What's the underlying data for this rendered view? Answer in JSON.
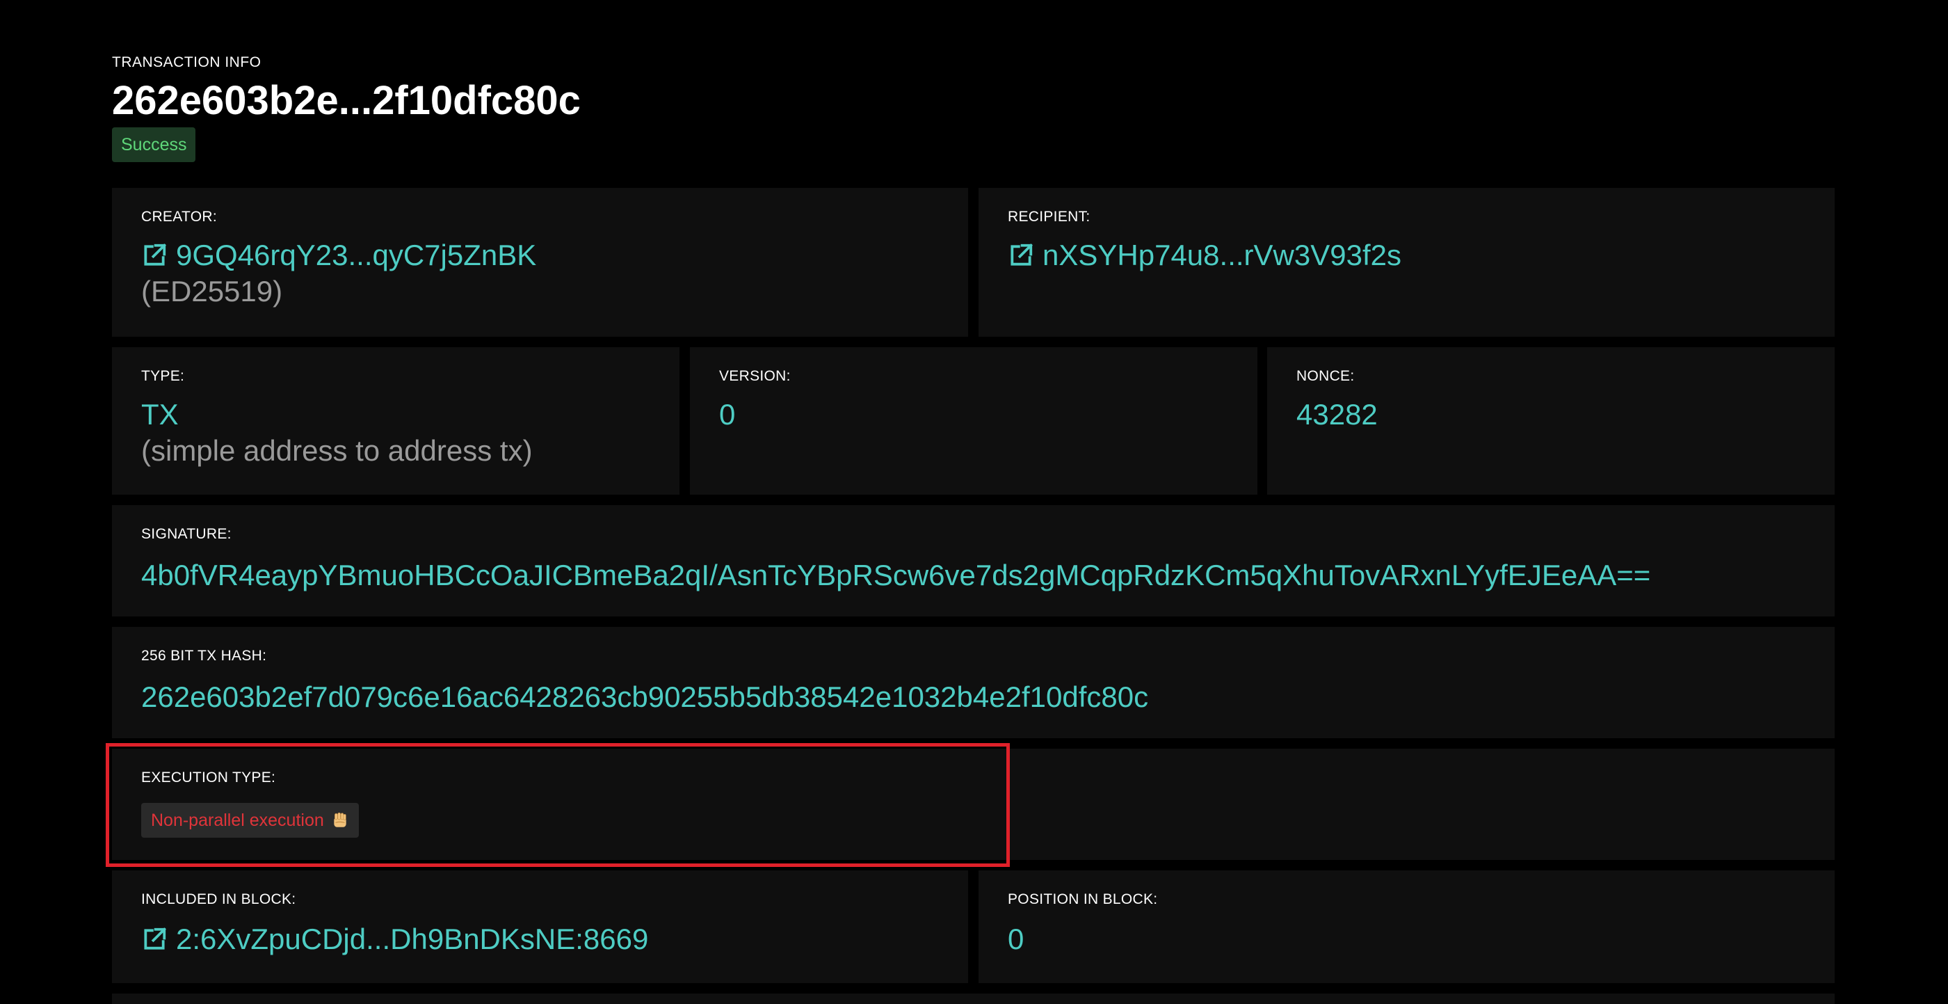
{
  "header": {
    "eyebrow": "TRANSACTION INFO",
    "title": "262e603b2e...2f10dfc80c",
    "status": "Success"
  },
  "creator": {
    "label": "CREATOR:",
    "value": "9GQ46rqY23...qyC7j5ZnBK",
    "sub": "(ED25519)",
    "icon": "external-link-icon"
  },
  "recipient": {
    "label": "RECIPIENT:",
    "value": "nXSYHp74u8...rVw3V93f2s",
    "icon": "external-link-icon"
  },
  "type": {
    "label": "TYPE:",
    "value": "TX",
    "sub": "(simple address to address tx)"
  },
  "version": {
    "label": "VERSION:",
    "value": "0"
  },
  "nonce": {
    "label": "NONCE:",
    "value": "43282"
  },
  "signature": {
    "label": "SIGNATURE:",
    "value": "4b0fVR4eaypYBmuoHBCcOaJICBmeBa2qI/AsnTcYBpRScw6ve7ds2gMCqpRdzKCm5qXhuTovARxnLYyfEJEeAA=="
  },
  "tx_hash": {
    "label": "256 BIT TX HASH:",
    "value": "262e603b2ef7d079c6e16ac6428263cb90255b5db38542e1032b4e2f10dfc80c"
  },
  "execution": {
    "label": "EXECUTION TYPE:",
    "value": "Non-parallel execution",
    "icon": "raised-fist-emoji-icon"
  },
  "block": {
    "label": "INCLUDED IN BLOCK:",
    "value": "2:6XvZpuCDjd...Dh9BnDKsNE:8669",
    "icon": "external-link-icon"
  },
  "position": {
    "label": "POSITION IN BLOCK:",
    "value": "0"
  },
  "colors": {
    "background": "#000000",
    "card": "#0f0f0f",
    "accent": "#4ecdc4",
    "success_bg": "#1c3a24",
    "success_text": "#5fd77a",
    "error_text": "#e0343a",
    "highlight": "#e0212a"
  }
}
